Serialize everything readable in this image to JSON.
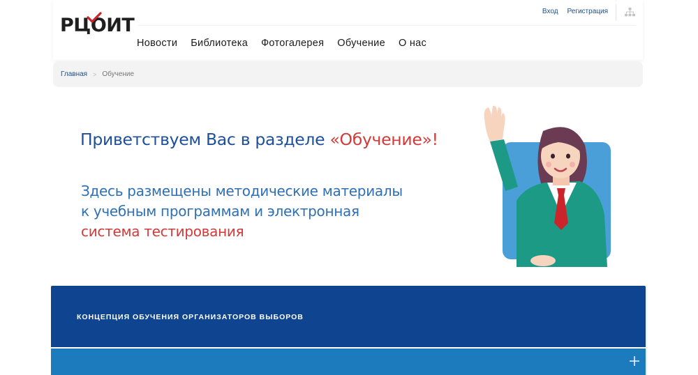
{
  "logo": {
    "text": "РЦОИТ",
    "check_color": "#c9252b"
  },
  "top_links": {
    "login": "Вход",
    "register": "Регистрация"
  },
  "nav": [
    {
      "label": "Новости"
    },
    {
      "label": "Библиотека"
    },
    {
      "label": "Фотогалерея"
    },
    {
      "label": "Обучение"
    },
    {
      "label": "О нас"
    }
  ],
  "breadcrumb": {
    "home": "Главная",
    "separator": ">",
    "current": "Обучение"
  },
  "banner": {
    "welcome_prefix": "Приветствуем Вас в разделе ",
    "welcome_accent": "«Обучение»!",
    "line1": "Здесь размещены методические материалы",
    "line2": "к учебным программам и электронная",
    "line3": "система тестирования"
  },
  "concept": {
    "title": "КОНЦЕПЦИЯ ОБУЧЕНИЯ ОРГАНИЗАТОРОВ ВЫБОРОВ"
  },
  "accordion": {
    "expand_icon": "plus-icon"
  },
  "icons": {
    "sitemap": "sitemap-icon",
    "checkmark": "checkmark-icon"
  },
  "colors": {
    "brand_blue": "#0f4590",
    "accordion_blue": "#1b7bbd",
    "heading_blue": "#1d4f9a",
    "text_blue": "#2f6fb5",
    "accent_red": "#d23a3a"
  }
}
